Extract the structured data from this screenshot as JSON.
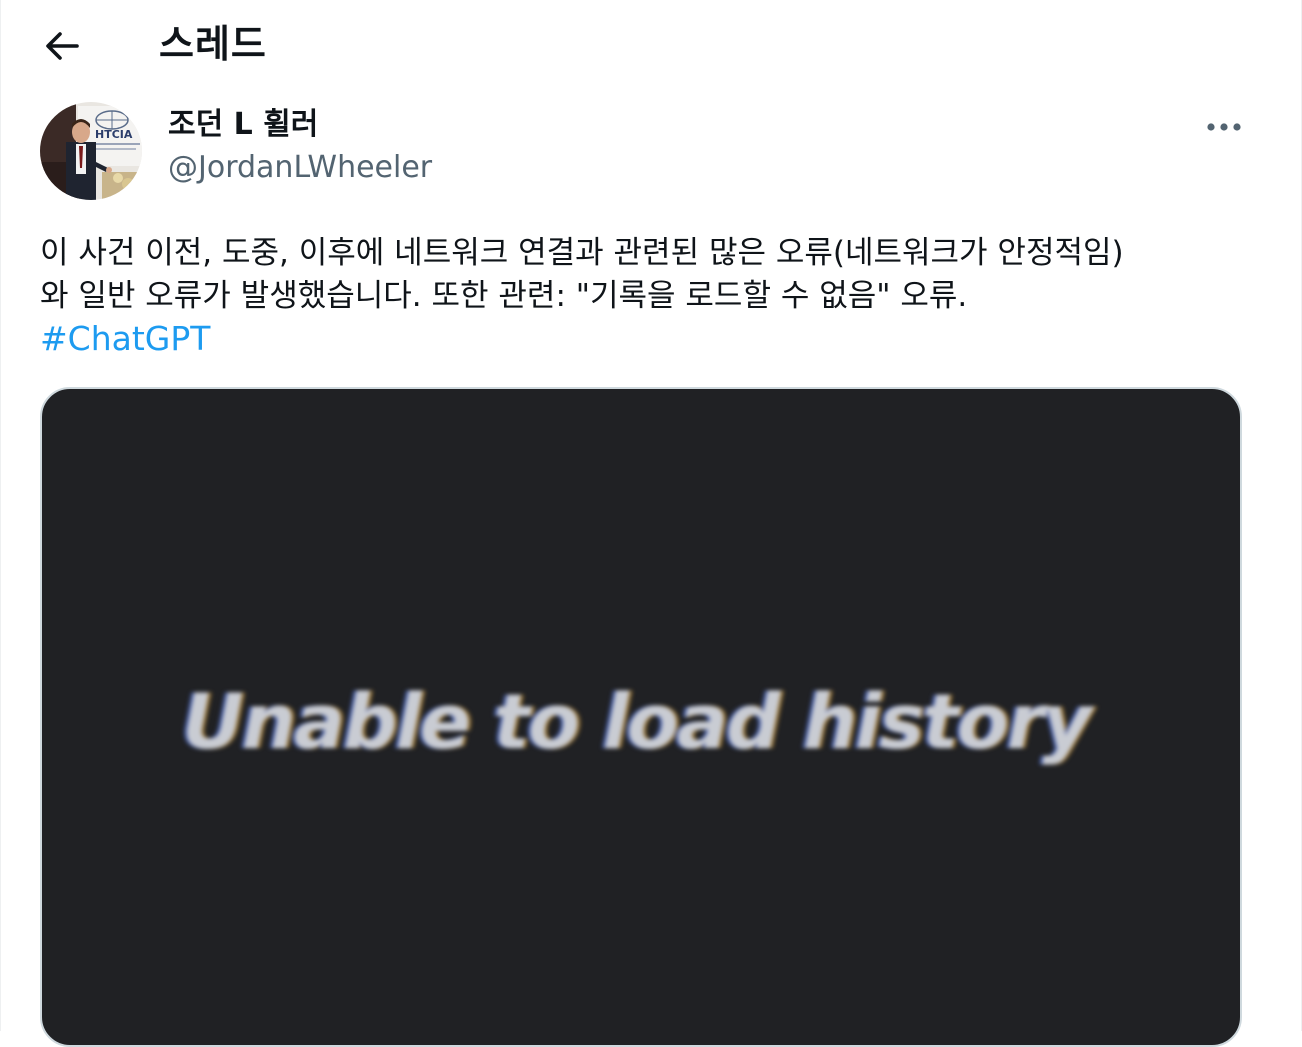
{
  "header": {
    "back_icon": "arrow-left-icon",
    "title": "스레드"
  },
  "author": {
    "display_name": "조던 L 휠러",
    "handle": "@JordanLWheeler",
    "avatar_banner_text": "HTCIA",
    "more_icon": "more-horizontal-icon"
  },
  "tweet": {
    "text": "이 사건 이전, 도중, 이후에 네트워크 연결과 관련된 많은 오류(네트워크가 안정적임)\n와 일반 오류가 발생했습니다. 또한 관련: \"기록을 로드할 수 없음\" 오류.",
    "hashtag": "#ChatGPT",
    "hashtag_color": "#1d9bf0"
  },
  "media": {
    "image_text": "Unable to load history",
    "background_color": "#202124"
  }
}
